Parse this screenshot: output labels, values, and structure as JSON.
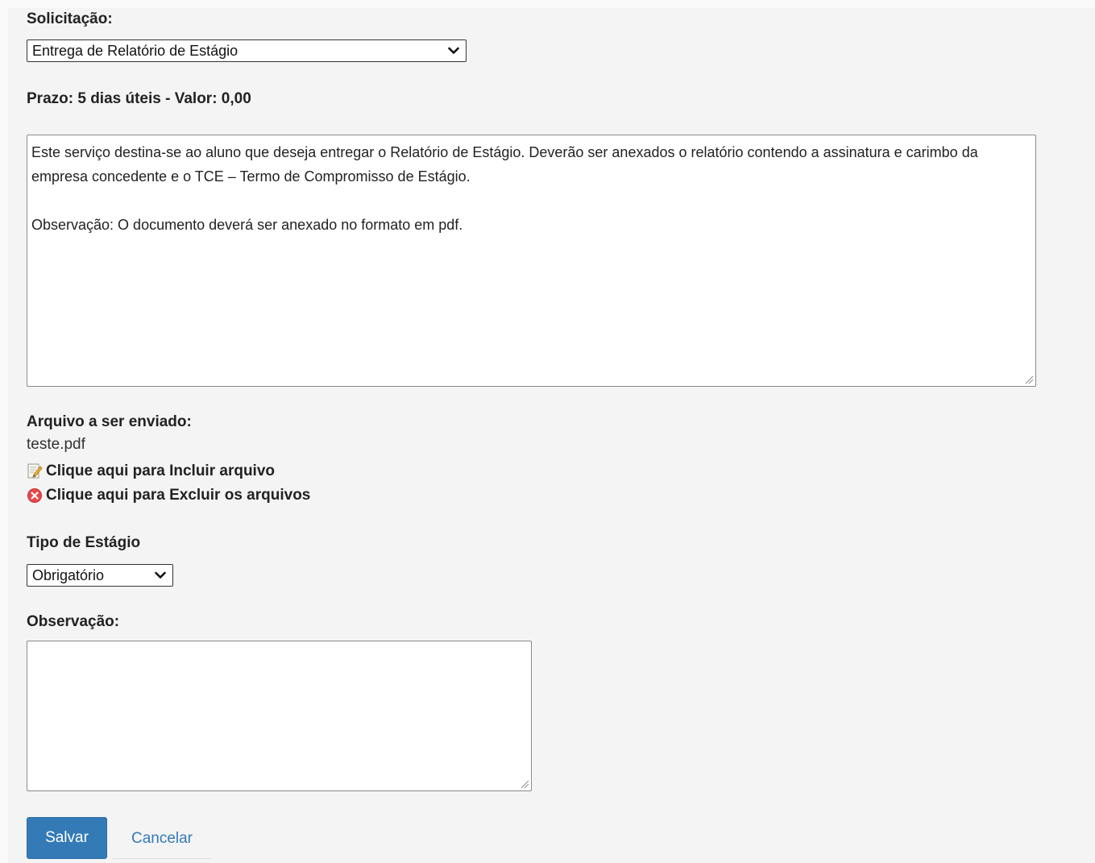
{
  "form": {
    "solicitacao_label": "Solicitação:",
    "solicitacao_value": "Entrega de Relatório de Estágio",
    "prazo_text": "Prazo: 5 dias úteis - Valor: 0,00",
    "description": "Este serviço destina-se ao aluno que deseja entregar o Relatório de Estágio. Deverão ser anexados o relatório contendo a assinatura e carimbo da empresa concedente e o TCE – Termo de Compromisso de Estágio.\n\nObservação: O documento deverá ser anexado no formato em pdf.",
    "arquivo_label": "Arquivo a ser enviado:",
    "arquivo_name": "teste.pdf",
    "incluir_link": "Clique aqui para Incluir arquivo",
    "excluir_link": "Clique aqui para Excluir os arquivos",
    "tipo_label": "Tipo de Estágio",
    "tipo_value": "Obrigatório",
    "observacao_label": "Observação:",
    "observacao_value": ""
  },
  "buttons": {
    "save": "Salvar",
    "cancel": "Cancelar"
  },
  "icons": {
    "include": "edit-document-icon",
    "exclude": "delete-circle-icon"
  },
  "colors": {
    "primary": "#337ab7",
    "danger": "#e8474a"
  }
}
